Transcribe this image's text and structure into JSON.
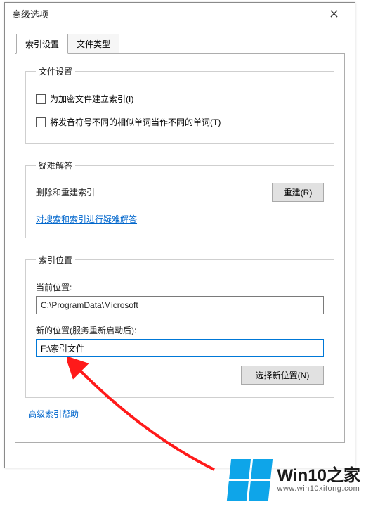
{
  "window": {
    "title": "高级选项"
  },
  "tabs": {
    "index_settings": "索引设置",
    "file_types": "文件类型"
  },
  "file_settings": {
    "legend": "文件设置",
    "encrypt_label": "为加密文件建立索引(I)",
    "diacritics_label": "将发音符号不同的相似单词当作不同的单词(T)"
  },
  "troubleshoot": {
    "legend": "疑难解答",
    "delete_rebuild_text": "删除和重建索引",
    "rebuild_btn": "重建(R)",
    "link": "对搜索和索引进行疑难解答"
  },
  "index_location": {
    "legend": "索引位置",
    "current_label": "当前位置:",
    "current_value": "C:\\ProgramData\\Microsoft",
    "new_label": "新的位置(服务重新启动后):",
    "new_value": "F:\\索引文件",
    "select_btn": "选择新位置(N)"
  },
  "footer": {
    "help_link": "高级索引帮助"
  },
  "watermark": {
    "brand": "Win10之家",
    "url": "www.win10xitong.com"
  }
}
